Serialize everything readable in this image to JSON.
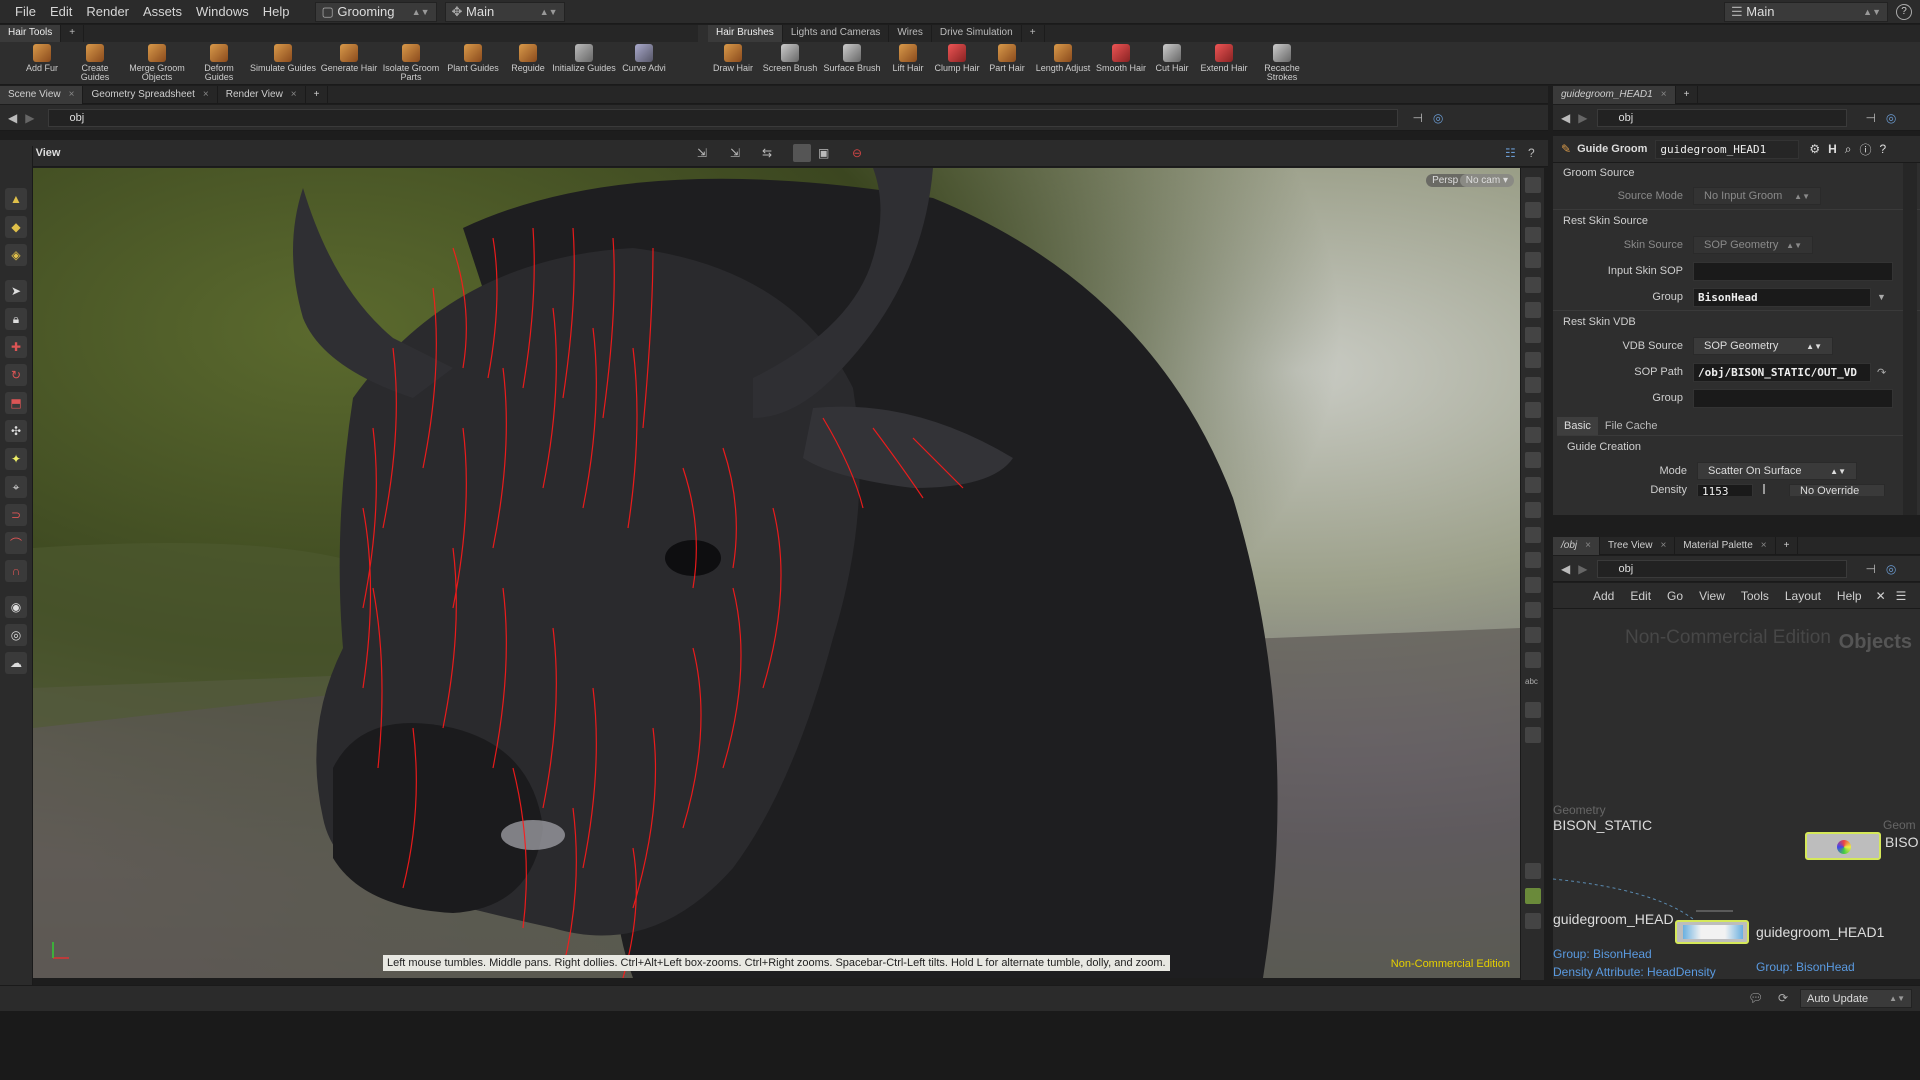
{
  "menubar": {
    "menus": [
      "File",
      "Edit",
      "Render",
      "Assets",
      "Windows",
      "Help"
    ],
    "desktop": "Grooming",
    "context": "Main",
    "right_context": "Main"
  },
  "shelf_left": {
    "tab": "Hair Tools",
    "tools": [
      "Add Fur",
      "Create Guides",
      "Merge Groom Objects",
      "Deform Guides",
      "Simulate Guides",
      "Generate Hair",
      "Isolate Groom Parts",
      "Plant Guides",
      "Reguide",
      "Initialize Guides",
      "Curve Advi"
    ]
  },
  "shelf_right": {
    "tabs": [
      "Hair Brushes",
      "Lights and Cameras",
      "Wires",
      "Drive Simulation"
    ],
    "tools": [
      "Draw Hair",
      "Screen Brush",
      "Surface Brush",
      "Lift Hair",
      "Clump Hair",
      "Part Hair",
      "Length Adjust",
      "Smooth Hair",
      "Cut Hair",
      "Extend Hair",
      "Recache Strokes"
    ]
  },
  "viewer": {
    "tabs": [
      "Scene View",
      "Geometry Spreadsheet",
      "Render View"
    ],
    "path": "obj",
    "title": "View",
    "persp": "Persp",
    "cam": "No cam",
    "help_text": "Left mouse tumbles. Middle pans. Right dollies. Ctrl+Alt+Left box-zooms. Ctrl+Right zooms. Spacebar-Ctrl-Left tilts. Hold L for alternate tumble, dolly, and zoom.",
    "watermark": "Non-Commercial Edition"
  },
  "params": {
    "tab": "guidegroom_HEAD1",
    "path": "obj",
    "node_type": "Guide Groom",
    "node_name": "guidegroom_HEAD1",
    "groom_source": "Groom Source",
    "source_mode_label": "Source Mode",
    "source_mode_value": "No Input Groom",
    "rest_skin_source": "Rest Skin Source",
    "skin_source_label": "Skin Source",
    "skin_source_value": "SOP Geometry",
    "input_skin_sop_label": "Input Skin SOP",
    "group_label": "Group",
    "group_value": "BisonHead",
    "rest_skin_vdb": "Rest Skin VDB",
    "vdb_source_label": "VDB Source",
    "vdb_source_value": "SOP Geometry",
    "sop_path_label": "SOP Path",
    "sop_path_value": "/obj/BISON_STATIC/OUT_VD",
    "group2_label": "Group",
    "subtabs": [
      "Basic",
      "File Cache"
    ],
    "guide_creation": "Guide Creation",
    "mode_label": "Mode",
    "mode_value": "Scatter On Surface",
    "density_label": "Density",
    "density_value": "1153",
    "no_override": "No Override"
  },
  "network": {
    "tabs": [
      "/obj",
      "Tree View",
      "Material Palette"
    ],
    "path": "obj",
    "menus": [
      "Add",
      "Edit",
      "Go",
      "View",
      "Tools",
      "Layout",
      "Help"
    ],
    "watermark": "Non-Commercial Edition",
    "context_label": "Objects",
    "node1_type": "Geometry",
    "node1_name": "BISON_STATIC",
    "node2_type": "Geom",
    "node2_name": "BISO",
    "node3_name": "guidegroom_HEAD",
    "node3_group": "Group: BisonHead",
    "node3_density": "Density Attribute: HeadDensity",
    "node4_name": "guidegroom_HEAD1",
    "node4_group": "Group: BisonHead",
    "auto_update": "Auto Update"
  }
}
